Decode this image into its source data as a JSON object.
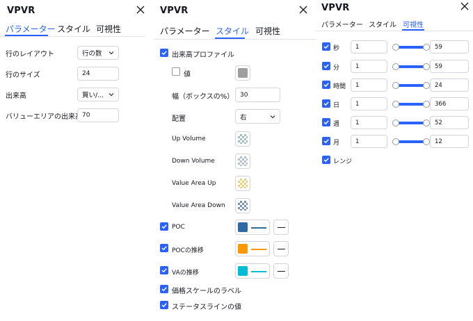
{
  "panel1": {
    "title": "VPVR",
    "tabs": [
      "パラメーター",
      "スタイル",
      "可視性"
    ],
    "rows": [
      {
        "label": "行のレイアウト",
        "value": "行の数",
        "kind": "select"
      },
      {
        "label": "行のサイズ",
        "value": "24",
        "kind": "input"
      },
      {
        "label": "出来高",
        "value": "買い/...",
        "kind": "select"
      },
      {
        "label": "バリューエリアの出来高",
        "value": "70",
        "kind": "input"
      }
    ]
  },
  "panel2": {
    "title": "VPVR",
    "tabs": [
      "パラメーター",
      "スタイル",
      "可視性"
    ],
    "volume_profile_label": "出来高プロファイル",
    "values_label": "値",
    "width_label": "幅（ボックスの%）",
    "width_value": "30",
    "placement_label": "配置",
    "placement_value": "右",
    "up_volume_label": "Up Volume",
    "down_volume_label": "Down Volume",
    "va_up_label": "Value Area Up",
    "va_down_label": "Value Area Down",
    "poc_label": "POC",
    "poc_trend_label": "POCの推移",
    "va_trend_label": "VAの推移",
    "price_scale_label": "価格スケールのラベル",
    "status_line_label": "ステータスラインの値",
    "colors": {
      "value_grey": "#9e9e9e",
      "up_volume": "#8fb7bd",
      "down_volume": "#a3b5cc",
      "va_up": "#ecc75a",
      "va_down": "#5a7fae",
      "poc": "#2f6aa3",
      "poc_trend": "#ff9800",
      "va_trend": "#00bcd4",
      "accent": "#2962ff"
    }
  },
  "panel3": {
    "title": "VPVR",
    "tabs": [
      "パラメーター",
      "スタイル",
      "可視性"
    ],
    "rows": [
      {
        "label": "秒",
        "min": "1",
        "max": "59"
      },
      {
        "label": "分",
        "min": "1",
        "max": "59"
      },
      {
        "label": "時間",
        "min": "1",
        "max": "24"
      },
      {
        "label": "日",
        "min": "1",
        "max": "366"
      },
      {
        "label": "週",
        "min": "1",
        "max": "52"
      },
      {
        "label": "月",
        "min": "1",
        "max": "12"
      }
    ],
    "ranges_label": "レンジ"
  },
  "icons": {
    "close": "close-icon",
    "check": "checkmark-icon",
    "chevron": "chevron-down-icon"
  }
}
